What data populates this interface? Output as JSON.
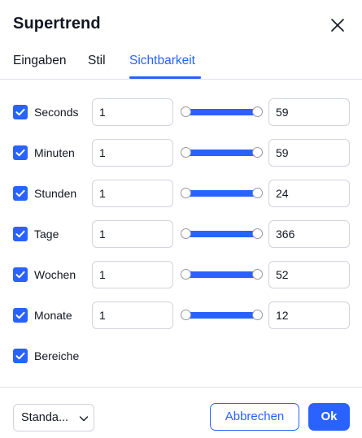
{
  "header": {
    "title": "Supertrend"
  },
  "tabs": [
    {
      "label": "Eingaben",
      "active": false
    },
    {
      "label": "Stil",
      "active": false
    },
    {
      "label": "Sichtbarkeit",
      "active": true
    }
  ],
  "visibility": {
    "rows": [
      {
        "label": "Seconds",
        "checked": true,
        "from": "1",
        "to": "59"
      },
      {
        "label": "Minuten",
        "checked": true,
        "from": "1",
        "to": "59"
      },
      {
        "label": "Stunden",
        "checked": true,
        "from": "1",
        "to": "24"
      },
      {
        "label": "Tage",
        "checked": true,
        "from": "1",
        "to": "366"
      },
      {
        "label": "Wochen",
        "checked": true,
        "from": "1",
        "to": "52"
      },
      {
        "label": "Monate",
        "checked": true,
        "from": "1",
        "to": "12"
      }
    ],
    "ranges": {
      "label": "Bereiche",
      "checked": true
    }
  },
  "footer": {
    "template_select": "Standa...",
    "cancel_label": "Abbrechen",
    "ok_label": "Ok"
  },
  "colors": {
    "accent": "#2962ff",
    "border": "#d1d4dc",
    "text": "#131722"
  }
}
